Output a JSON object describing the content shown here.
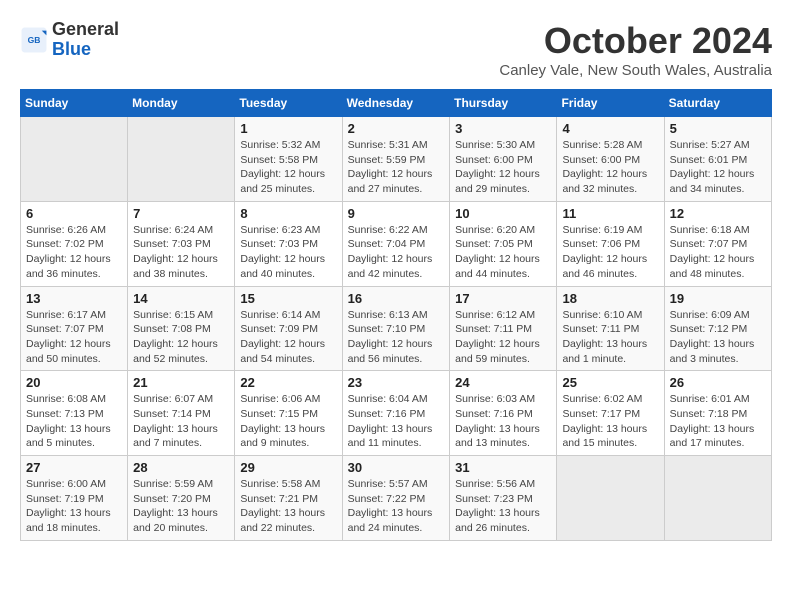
{
  "logo": {
    "line1": "General",
    "line2": "Blue"
  },
  "title": "October 2024",
  "subtitle": "Canley Vale, New South Wales, Australia",
  "days_of_week": [
    "Sunday",
    "Monday",
    "Tuesday",
    "Wednesday",
    "Thursday",
    "Friday",
    "Saturday"
  ],
  "weeks": [
    [
      {
        "day": "",
        "sunrise": "",
        "sunset": "",
        "daylight": "",
        "empty": true
      },
      {
        "day": "",
        "sunrise": "",
        "sunset": "",
        "daylight": "",
        "empty": true
      },
      {
        "day": "1",
        "sunrise": "Sunrise: 5:32 AM",
        "sunset": "Sunset: 5:58 PM",
        "daylight": "Daylight: 12 hours and 25 minutes.",
        "empty": false
      },
      {
        "day": "2",
        "sunrise": "Sunrise: 5:31 AM",
        "sunset": "Sunset: 5:59 PM",
        "daylight": "Daylight: 12 hours and 27 minutes.",
        "empty": false
      },
      {
        "day": "3",
        "sunrise": "Sunrise: 5:30 AM",
        "sunset": "Sunset: 6:00 PM",
        "daylight": "Daylight: 12 hours and 29 minutes.",
        "empty": false
      },
      {
        "day": "4",
        "sunrise": "Sunrise: 5:28 AM",
        "sunset": "Sunset: 6:00 PM",
        "daylight": "Daylight: 12 hours and 32 minutes.",
        "empty": false
      },
      {
        "day": "5",
        "sunrise": "Sunrise: 5:27 AM",
        "sunset": "Sunset: 6:01 PM",
        "daylight": "Daylight: 12 hours and 34 minutes.",
        "empty": false
      }
    ],
    [
      {
        "day": "6",
        "sunrise": "Sunrise: 6:26 AM",
        "sunset": "Sunset: 7:02 PM",
        "daylight": "Daylight: 12 hours and 36 minutes.",
        "empty": false
      },
      {
        "day": "7",
        "sunrise": "Sunrise: 6:24 AM",
        "sunset": "Sunset: 7:03 PM",
        "daylight": "Daylight: 12 hours and 38 minutes.",
        "empty": false
      },
      {
        "day": "8",
        "sunrise": "Sunrise: 6:23 AM",
        "sunset": "Sunset: 7:03 PM",
        "daylight": "Daylight: 12 hours and 40 minutes.",
        "empty": false
      },
      {
        "day": "9",
        "sunrise": "Sunrise: 6:22 AM",
        "sunset": "Sunset: 7:04 PM",
        "daylight": "Daylight: 12 hours and 42 minutes.",
        "empty": false
      },
      {
        "day": "10",
        "sunrise": "Sunrise: 6:20 AM",
        "sunset": "Sunset: 7:05 PM",
        "daylight": "Daylight: 12 hours and 44 minutes.",
        "empty": false
      },
      {
        "day": "11",
        "sunrise": "Sunrise: 6:19 AM",
        "sunset": "Sunset: 7:06 PM",
        "daylight": "Daylight: 12 hours and 46 minutes.",
        "empty": false
      },
      {
        "day": "12",
        "sunrise": "Sunrise: 6:18 AM",
        "sunset": "Sunset: 7:07 PM",
        "daylight": "Daylight: 12 hours and 48 minutes.",
        "empty": false
      }
    ],
    [
      {
        "day": "13",
        "sunrise": "Sunrise: 6:17 AM",
        "sunset": "Sunset: 7:07 PM",
        "daylight": "Daylight: 12 hours and 50 minutes.",
        "empty": false
      },
      {
        "day": "14",
        "sunrise": "Sunrise: 6:15 AM",
        "sunset": "Sunset: 7:08 PM",
        "daylight": "Daylight: 12 hours and 52 minutes.",
        "empty": false
      },
      {
        "day": "15",
        "sunrise": "Sunrise: 6:14 AM",
        "sunset": "Sunset: 7:09 PM",
        "daylight": "Daylight: 12 hours and 54 minutes.",
        "empty": false
      },
      {
        "day": "16",
        "sunrise": "Sunrise: 6:13 AM",
        "sunset": "Sunset: 7:10 PM",
        "daylight": "Daylight: 12 hours and 56 minutes.",
        "empty": false
      },
      {
        "day": "17",
        "sunrise": "Sunrise: 6:12 AM",
        "sunset": "Sunset: 7:11 PM",
        "daylight": "Daylight: 12 hours and 59 minutes.",
        "empty": false
      },
      {
        "day": "18",
        "sunrise": "Sunrise: 6:10 AM",
        "sunset": "Sunset: 7:11 PM",
        "daylight": "Daylight: 13 hours and 1 minute.",
        "empty": false
      },
      {
        "day": "19",
        "sunrise": "Sunrise: 6:09 AM",
        "sunset": "Sunset: 7:12 PM",
        "daylight": "Daylight: 13 hours and 3 minutes.",
        "empty": false
      }
    ],
    [
      {
        "day": "20",
        "sunrise": "Sunrise: 6:08 AM",
        "sunset": "Sunset: 7:13 PM",
        "daylight": "Daylight: 13 hours and 5 minutes.",
        "empty": false
      },
      {
        "day": "21",
        "sunrise": "Sunrise: 6:07 AM",
        "sunset": "Sunset: 7:14 PM",
        "daylight": "Daylight: 13 hours and 7 minutes.",
        "empty": false
      },
      {
        "day": "22",
        "sunrise": "Sunrise: 6:06 AM",
        "sunset": "Sunset: 7:15 PM",
        "daylight": "Daylight: 13 hours and 9 minutes.",
        "empty": false
      },
      {
        "day": "23",
        "sunrise": "Sunrise: 6:04 AM",
        "sunset": "Sunset: 7:16 PM",
        "daylight": "Daylight: 13 hours and 11 minutes.",
        "empty": false
      },
      {
        "day": "24",
        "sunrise": "Sunrise: 6:03 AM",
        "sunset": "Sunset: 7:16 PM",
        "daylight": "Daylight: 13 hours and 13 minutes.",
        "empty": false
      },
      {
        "day": "25",
        "sunrise": "Sunrise: 6:02 AM",
        "sunset": "Sunset: 7:17 PM",
        "daylight": "Daylight: 13 hours and 15 minutes.",
        "empty": false
      },
      {
        "day": "26",
        "sunrise": "Sunrise: 6:01 AM",
        "sunset": "Sunset: 7:18 PM",
        "daylight": "Daylight: 13 hours and 17 minutes.",
        "empty": false
      }
    ],
    [
      {
        "day": "27",
        "sunrise": "Sunrise: 6:00 AM",
        "sunset": "Sunset: 7:19 PM",
        "daylight": "Daylight: 13 hours and 18 minutes.",
        "empty": false
      },
      {
        "day": "28",
        "sunrise": "Sunrise: 5:59 AM",
        "sunset": "Sunset: 7:20 PM",
        "daylight": "Daylight: 13 hours and 20 minutes.",
        "empty": false
      },
      {
        "day": "29",
        "sunrise": "Sunrise: 5:58 AM",
        "sunset": "Sunset: 7:21 PM",
        "daylight": "Daylight: 13 hours and 22 minutes.",
        "empty": false
      },
      {
        "day": "30",
        "sunrise": "Sunrise: 5:57 AM",
        "sunset": "Sunset: 7:22 PM",
        "daylight": "Daylight: 13 hours and 24 minutes.",
        "empty": false
      },
      {
        "day": "31",
        "sunrise": "Sunrise: 5:56 AM",
        "sunset": "Sunset: 7:23 PM",
        "daylight": "Daylight: 13 hours and 26 minutes.",
        "empty": false
      },
      {
        "day": "",
        "sunrise": "",
        "sunset": "",
        "daylight": "",
        "empty": true
      },
      {
        "day": "",
        "sunrise": "",
        "sunset": "",
        "daylight": "",
        "empty": true
      }
    ]
  ]
}
